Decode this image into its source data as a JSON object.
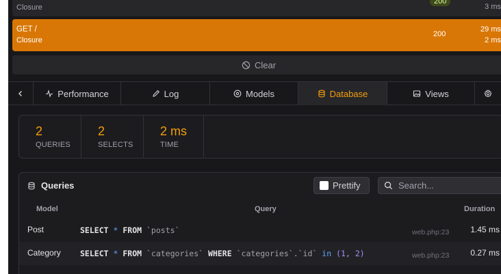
{
  "requests": [
    {
      "path": "",
      "handler": "Closure",
      "status": "200",
      "durations": [
        "3 ms"
      ]
    },
    {
      "path": "GET /",
      "handler": "Closure",
      "status": "200",
      "durations": [
        "29 ms",
        "2 ms"
      ]
    }
  ],
  "clear_label": "Clear",
  "tabs": [
    {
      "label": "Performance",
      "icon": "activity-icon"
    },
    {
      "label": "Log",
      "icon": "pencil-icon"
    },
    {
      "label": "Models",
      "icon": "target-icon"
    },
    {
      "label": "Database",
      "icon": "database-icon",
      "active": true
    },
    {
      "label": "Views",
      "icon": "image-icon"
    }
  ],
  "stats": [
    {
      "value": "2",
      "label": "QUERIES"
    },
    {
      "value": "2",
      "label": "SELECTS"
    },
    {
      "value": "2 ms",
      "label": "TIME"
    }
  ],
  "queries_panel": {
    "title": "Queries",
    "prettify_label": "Prettify",
    "search_placeholder": "Search...",
    "columns": [
      "Model",
      "Query",
      "Duration"
    ],
    "rows": [
      {
        "model": "Post",
        "query": "SELECT * FROM `posts`",
        "source": "web.php:23",
        "duration": "1.45 ms"
      },
      {
        "model": "Category",
        "query": "SELECT * FROM `categories` WHERE `categories`.`id` in (1, 2)",
        "source": "web.php:23",
        "duration": "0.27 ms"
      }
    ]
  },
  "colors": {
    "accent": "#f59e0b",
    "selected_request": "#d97706",
    "background": "#18181b"
  }
}
